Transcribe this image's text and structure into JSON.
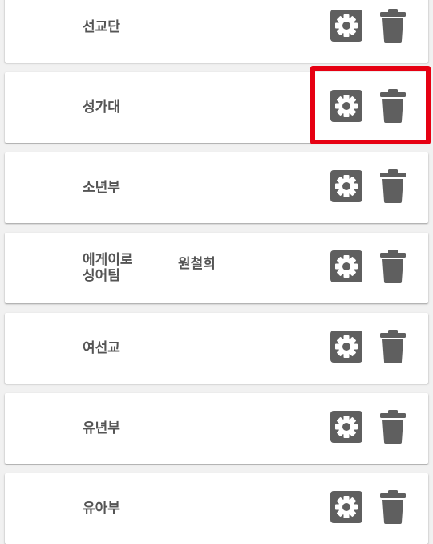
{
  "groups": [
    {
      "name": "선교단",
      "leader": ""
    },
    {
      "name": "성가대",
      "leader": ""
    },
    {
      "name": "소년부",
      "leader": ""
    },
    {
      "name": "에게이로\n싱어팀",
      "leader": "원철희"
    },
    {
      "name": "여선교",
      "leader": ""
    },
    {
      "name": "유년부",
      "leader": ""
    },
    {
      "name": "유아부",
      "leader": ""
    }
  ],
  "icons": {
    "settings": "gear-icon",
    "delete": "trash-icon"
  },
  "colors": {
    "icon": "#5f5f5f",
    "highlight": "#e60012",
    "text": "#555555"
  }
}
